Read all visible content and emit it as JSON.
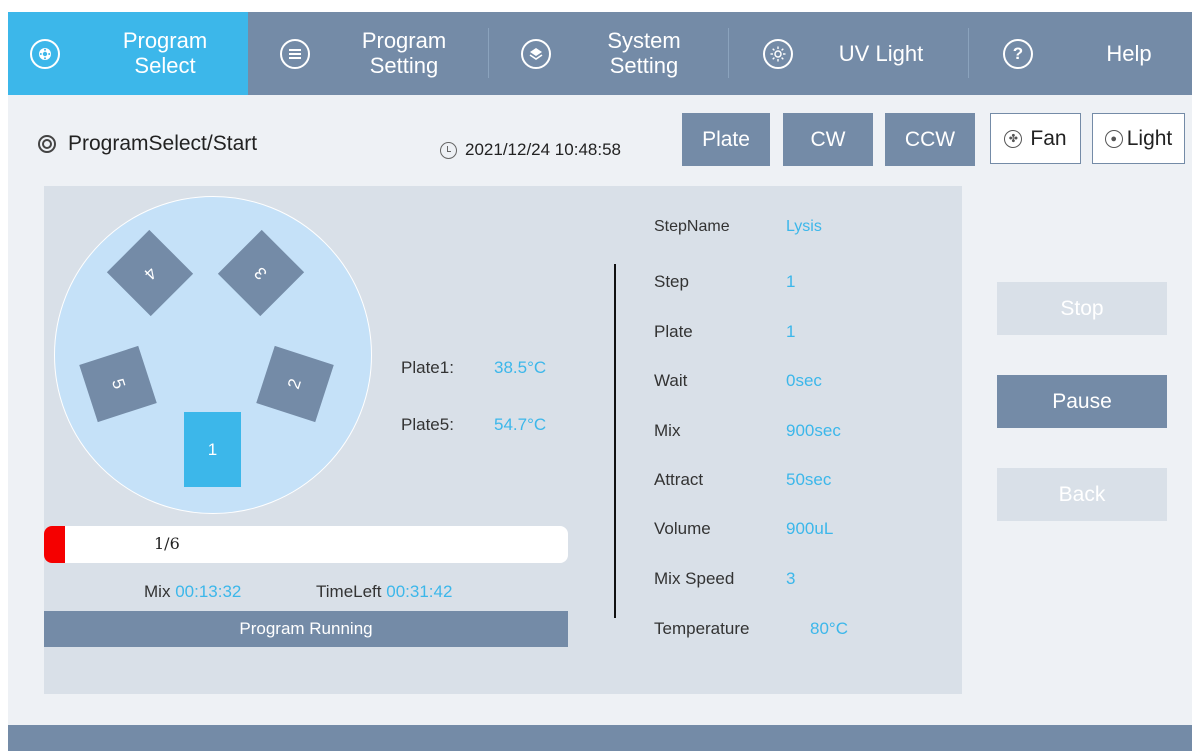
{
  "nav": {
    "tabs": [
      {
        "label": "Program\nSelect",
        "icon": "plate-icon",
        "active": true
      },
      {
        "label": "Program\nSetting",
        "icon": "list-icon",
        "active": false
      },
      {
        "label": "System\nSetting",
        "icon": "layers-icon",
        "active": false
      },
      {
        "label": "UV Light",
        "icon": "uv-sun-icon",
        "active": false
      },
      {
        "label": "Help",
        "icon": "question-icon",
        "active": false
      }
    ]
  },
  "header": {
    "breadcrumb": "ProgramSelect/Start",
    "datetime": "2021/12/24 10:48:58",
    "buttons": {
      "plate": "Plate",
      "cw": "CW",
      "ccw": "CCW",
      "fan": "Fan",
      "light": "Light"
    }
  },
  "plates": [
    {
      "number": "1",
      "active": true
    },
    {
      "number": "2",
      "active": false
    },
    {
      "number": "3",
      "active": false
    },
    {
      "number": "4",
      "active": false
    },
    {
      "number": "5",
      "active": false
    }
  ],
  "temperatures": [
    {
      "label": "Plate1:",
      "value": "38.5°C"
    },
    {
      "label": "Plate5:",
      "value": "54.7°C"
    }
  ],
  "progress": {
    "text": "1/6",
    "fraction": 0.04
  },
  "timers": {
    "mix_label": "Mix",
    "mix_value": "00:13:32",
    "left_label": "TimeLeft",
    "left_value": "00:31:42"
  },
  "status": "Program Running",
  "step_params": [
    {
      "label": "StepName",
      "value": "Lysis"
    },
    {
      "label": "Step",
      "value": "1"
    },
    {
      "label": "Plate",
      "value": "1"
    },
    {
      "label": "Wait",
      "value": "0sec"
    },
    {
      "label": "Mix",
      "value": "900sec"
    },
    {
      "label": "Attract",
      "value": "50sec"
    },
    {
      "label": "Volume",
      "value": "900uL"
    },
    {
      "label": "Mix Speed",
      "value": "3"
    },
    {
      "label": "Temperature",
      "value": "80°C"
    }
  ],
  "actions": {
    "stop": "Stop",
    "pause": "Pause",
    "back": "Back"
  },
  "colors": {
    "accent": "#3cb7ea",
    "slate": "#748ba7",
    "panel": "#d9e0e8",
    "alert": "#f50000"
  }
}
